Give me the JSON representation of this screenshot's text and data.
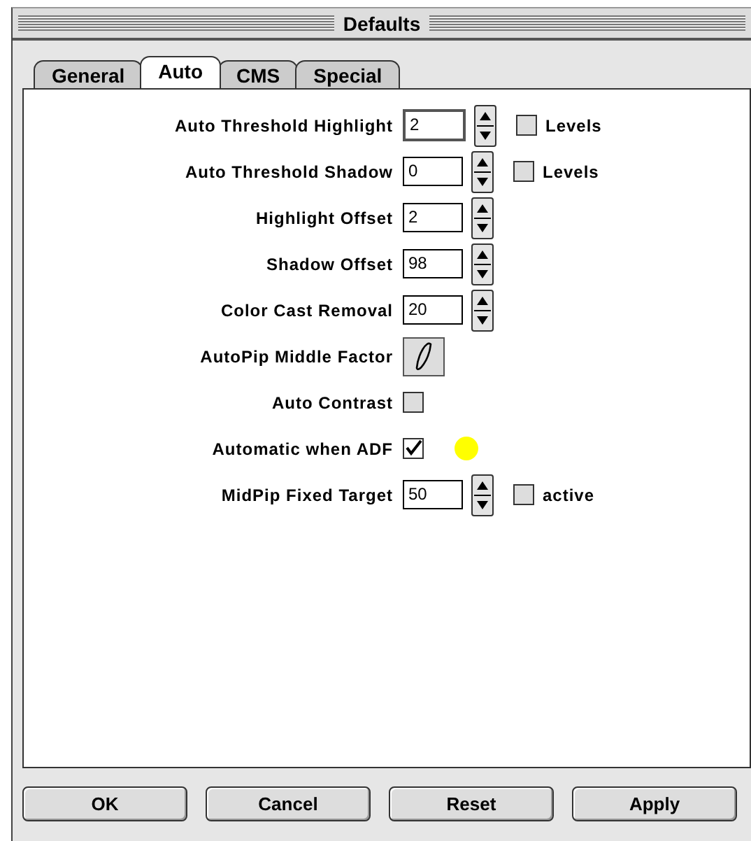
{
  "window": {
    "title": "Defaults"
  },
  "tabs": [
    {
      "label": "General",
      "selected": false
    },
    {
      "label": "Auto",
      "selected": true
    },
    {
      "label": "CMS",
      "selected": false
    },
    {
      "label": "Special",
      "selected": false
    }
  ],
  "rows": [
    {
      "kind": "field",
      "label": "Auto Threshold Highlight",
      "value": "2",
      "focused": true,
      "checkbox": {
        "label": "Levels",
        "checked": false
      }
    },
    {
      "kind": "field",
      "label": "Auto Threshold Shadow",
      "value": "0",
      "focused": false,
      "checkbox": {
        "label": "Levels",
        "checked": false
      }
    },
    {
      "kind": "field",
      "label": "Highlight Offset",
      "value": "2",
      "focused": false
    },
    {
      "kind": "field",
      "label": "Shadow Offset",
      "value": "98",
      "focused": false
    },
    {
      "kind": "field",
      "label": "Color Cast Removal",
      "value": "20",
      "focused": false
    },
    {
      "kind": "icon_button",
      "label": "AutoPip Middle Factor"
    },
    {
      "kind": "checkbox",
      "label": "Auto Contrast",
      "checked": false,
      "marker": false
    },
    {
      "kind": "checkbox",
      "label": "Automatic when ADF",
      "checked": true,
      "marker": true
    },
    {
      "kind": "field",
      "label": "MidPip Fixed Target",
      "value": "50",
      "focused": false,
      "checkbox": {
        "label": "active",
        "checked": false
      }
    }
  ],
  "buttons": [
    "OK",
    "Cancel",
    "Reset",
    "Apply"
  ]
}
